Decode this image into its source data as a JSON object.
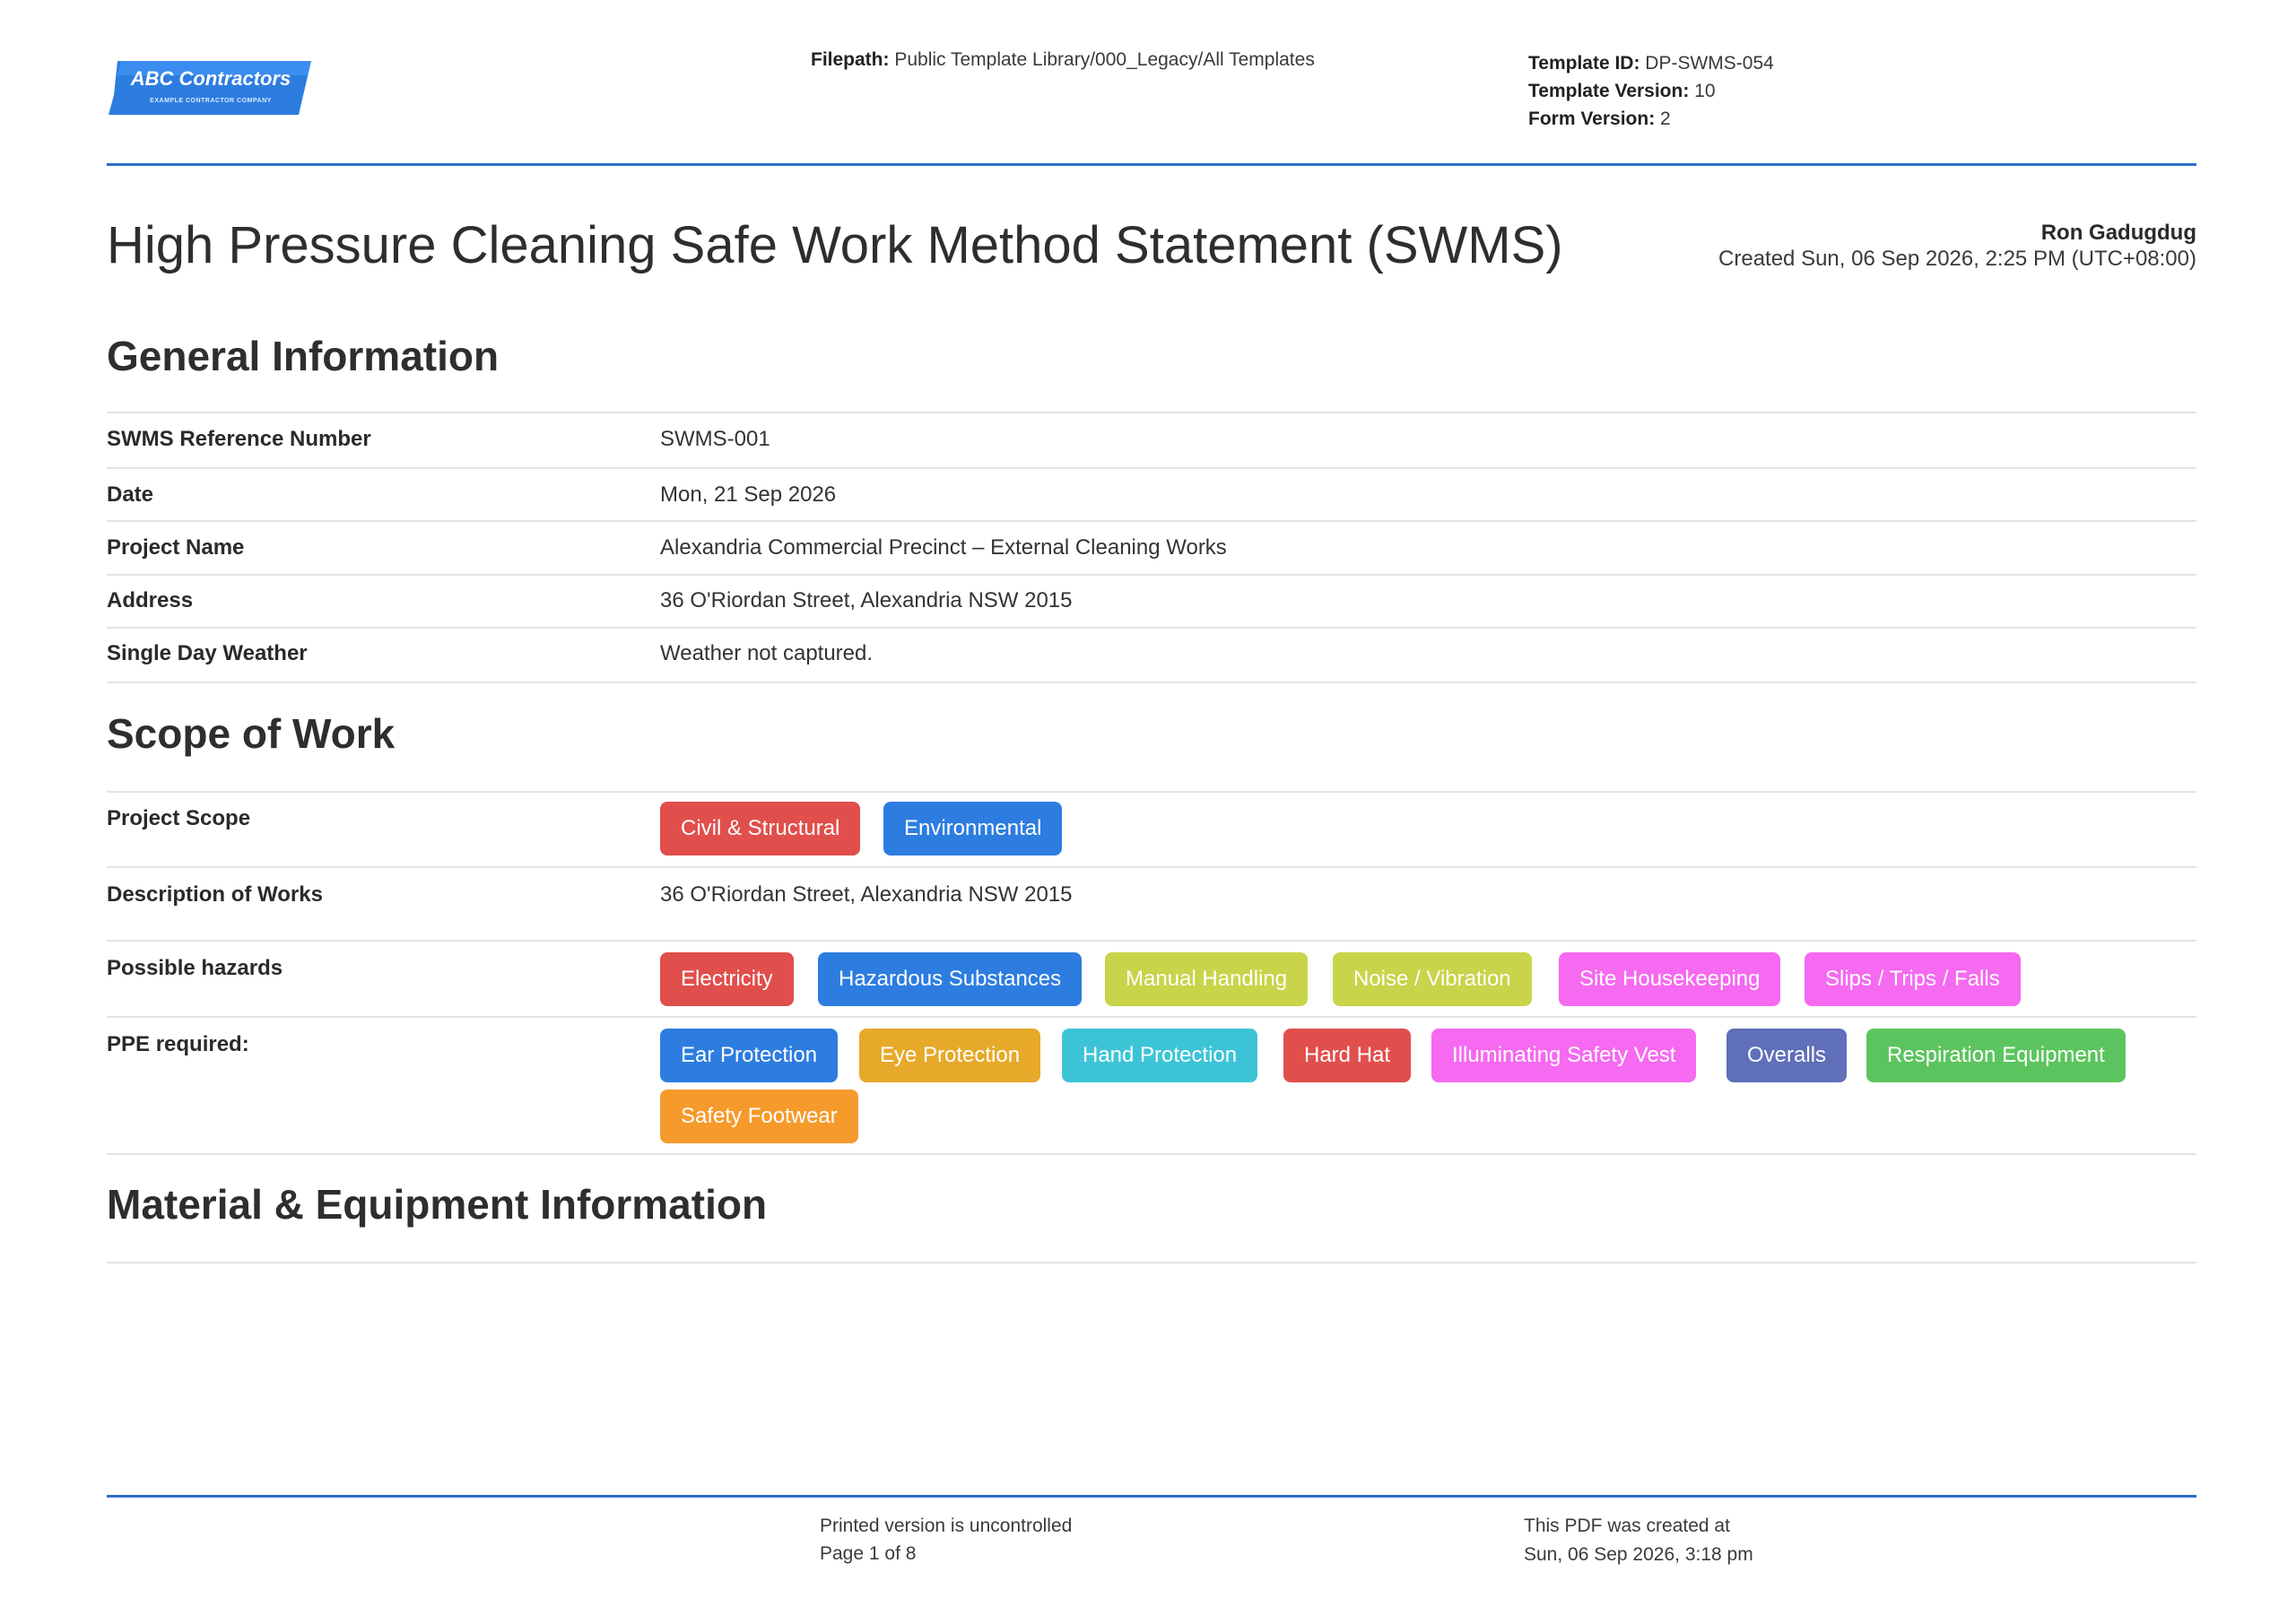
{
  "logo": {
    "title": "ABC Contractors",
    "subtitle": "EXAMPLE CONTRACTOR COMPANY",
    "color": "#2d7de0"
  },
  "header": {
    "filepath_label": "Filepath:",
    "filepath_value": " Public Template Library/000_Legacy/All Templates",
    "template_id_label": "Template ID:",
    "template_id_value": " DP-SWMS-054",
    "template_version_label": "Template Version:",
    "template_version_value": " 10",
    "form_version_label": "Form Version:",
    "form_version_value": " 2"
  },
  "document": {
    "title": "High Pressure Cleaning Safe Work Method Statement (SWMS)",
    "author": "Ron Gadugdug",
    "created": "Created Sun, 06 Sep 2026, 2:25 PM (UTC+08:00)"
  },
  "general": {
    "title": "General Information",
    "rows": [
      {
        "label": "SWMS Reference Number",
        "value": "SWMS-001"
      },
      {
        "label": "Date",
        "value": "Mon, 21 Sep 2026"
      },
      {
        "label": "Project Name",
        "value": "Alexandria Commercial Precinct – External Cleaning Works"
      },
      {
        "label": "Address",
        "value": "36 O'Riordan Street, Alexandria NSW 2015"
      },
      {
        "label": "Single Day Weather",
        "value": "Weather not captured."
      }
    ]
  },
  "scope": {
    "title": "Scope of Work",
    "project_scope_label": "Project Scope",
    "project_scope_tags": [
      {
        "label": "Civil & Structural",
        "color": "#e04f4c"
      },
      {
        "label": "Environmental",
        "color": "#2d7de0"
      }
    ],
    "description_label": "Description of Works",
    "description_value": "36 O'Riordan Street, Alexandria NSW 2015",
    "hazards_label": "Possible hazards",
    "hazards_tags": [
      {
        "label": "Electricity",
        "color": "#e04f4c"
      },
      {
        "label": "Hazardous Substances",
        "color": "#2d7de0"
      },
      {
        "label": "Manual Handling",
        "color": "#c8d44a"
      },
      {
        "label": "Noise / Vibration",
        "color": "#c8d44a"
      },
      {
        "label": "Site Housekeeping",
        "color": "#f56af0"
      },
      {
        "label": "Slips / Trips / Falls",
        "color": "#f56af0"
      }
    ],
    "ppe_label": "PPE required:",
    "ppe_tags": [
      {
        "label": "Ear Protection",
        "color": "#2d7de0"
      },
      {
        "label": "Eye Protection",
        "color": "#e6a92a"
      },
      {
        "label": "Hand Protection",
        "color": "#3cc4d6"
      },
      {
        "label": "Hard Hat",
        "color": "#e04f4c"
      },
      {
        "label": "Illuminating Safety Vest",
        "color": "#f56af0"
      },
      {
        "label": "Overalls",
        "color": "#5f6fb9"
      },
      {
        "label": "Respiration Equipment",
        "color": "#5cc45e"
      },
      {
        "label": "Safety Footwear",
        "color": "#f59a2b"
      }
    ]
  },
  "material": {
    "title": "Material & Equipment Information"
  },
  "footer": {
    "uncontrolled": "Printed version is uncontrolled",
    "page": "Page 1 of 8",
    "created_label": "This PDF was created at",
    "created_value": "Sun, 06 Sep 2026, 3:18 pm"
  }
}
